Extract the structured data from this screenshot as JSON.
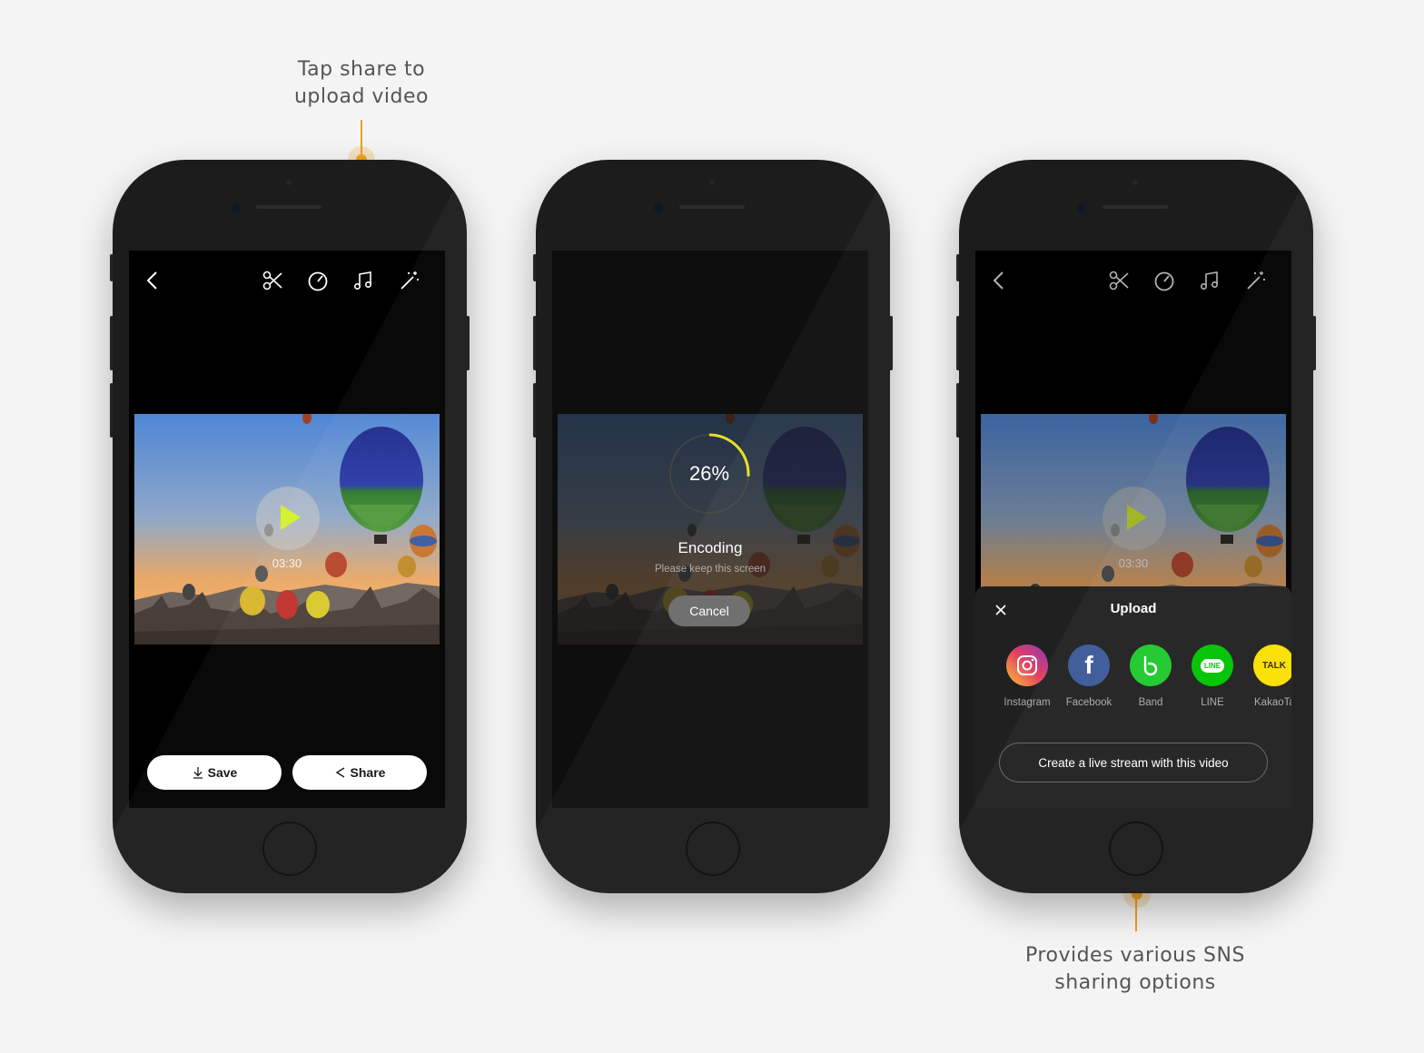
{
  "callouts": {
    "top_line1": "Tap share to",
    "top_line2": "upload video",
    "bottom_line1": "Provides various SNS",
    "bottom_line2": "sharing options",
    "accent_color": "#f2a020"
  },
  "editor": {
    "toolbar_icons": [
      "back-icon",
      "scissors-icon",
      "speed-icon",
      "music-icon",
      "magic-wand-icon"
    ],
    "duration": "03:30",
    "save_label": "Save",
    "share_label": "Share",
    "play_color": "#d4f02a"
  },
  "encoding": {
    "progress_percent": 26,
    "progress_text": "26%",
    "title": "Encoding",
    "subtitle": "Please keep this screen",
    "cancel_label": "Cancel",
    "progress_color": "#e8e020"
  },
  "upload": {
    "title": "Upload",
    "options": [
      {
        "label": "Instagram",
        "icon": "instagram-icon"
      },
      {
        "label": "Facebook",
        "icon": "facebook-icon"
      },
      {
        "label": "Band",
        "icon": "band-icon"
      },
      {
        "label": "LINE",
        "icon": "line-icon"
      },
      {
        "label": "KakaoTa",
        "icon": "kakaotalk-icon"
      }
    ],
    "line_badge": "LINE",
    "kakao_badge": "TALK",
    "live_stream_label": "Create a live stream with this video"
  }
}
